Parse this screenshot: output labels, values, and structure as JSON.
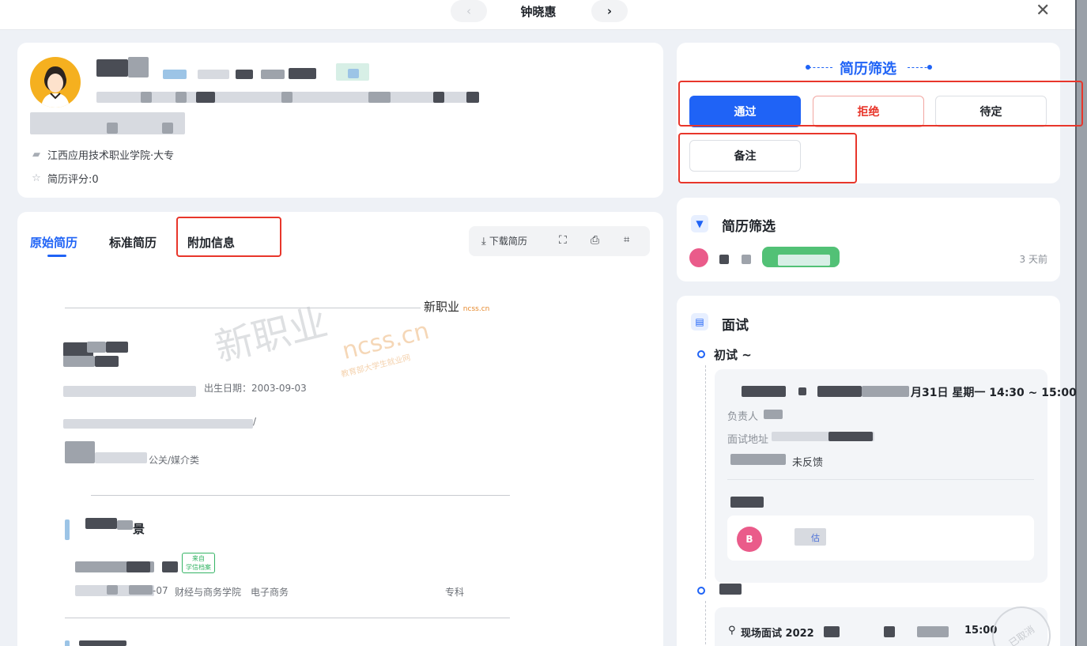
{
  "topbar": {
    "title": "钟晓惠",
    "prev_icon": "chevron-left-icon",
    "next_icon": "chevron-right-icon",
    "close_icon": "close-icon"
  },
  "profile": {
    "school": "江西应用技术职业学院·大专",
    "rating": "简历评分:0"
  },
  "resume": {
    "tabs": [
      "原始简历",
      "标准简历",
      "附加信息"
    ],
    "active_tab": 0,
    "toolbar": {
      "download_label": "下载简历",
      "fullscreen_icon": "fullscreen-icon",
      "print_icon": "print-icon",
      "ocr_icon": "scan-text-icon"
    },
    "document": {
      "brand": "新职业",
      "brand_url": "ncss.cn",
      "watermark": "新职业",
      "watermark_url": "ncss.cn",
      "watermark_sub": "教育部大学生就业网",
      "birth_date": "出生日期：2003-09-03",
      "field_fragment": "/",
      "industry_fragment": "公关/媒介类",
      "section_suffix": "景",
      "stamp_top": "来自",
      "stamp_bottom": "学信档案",
      "education_row": {
        "date_fragment": "-07",
        "college": "财经与商务学院",
        "major": "电子商务",
        "degree": "专科"
      }
    }
  },
  "screening_panel": {
    "title": "简历筛选",
    "actions": {
      "pass": "通过",
      "reject": "拒绝",
      "hold": "待定",
      "note": "备注"
    }
  },
  "screening_history": {
    "title": "简历筛选",
    "time_ago": "3 天前"
  },
  "interview": {
    "title": "面试",
    "round": "初试 ~",
    "schedule_fragment": "月31日 星期一 14:30 ~ 15:00",
    "owner_fragment": "负责人",
    "location_fragment": "面试地址",
    "feedback_fragment": "未反馈",
    "evaluator_avatar": "B",
    "eval_fragment": "估",
    "onsite": "现场面试 2022",
    "onsite_time_fragment": "15:00",
    "cancel_stamp": "已取消"
  }
}
